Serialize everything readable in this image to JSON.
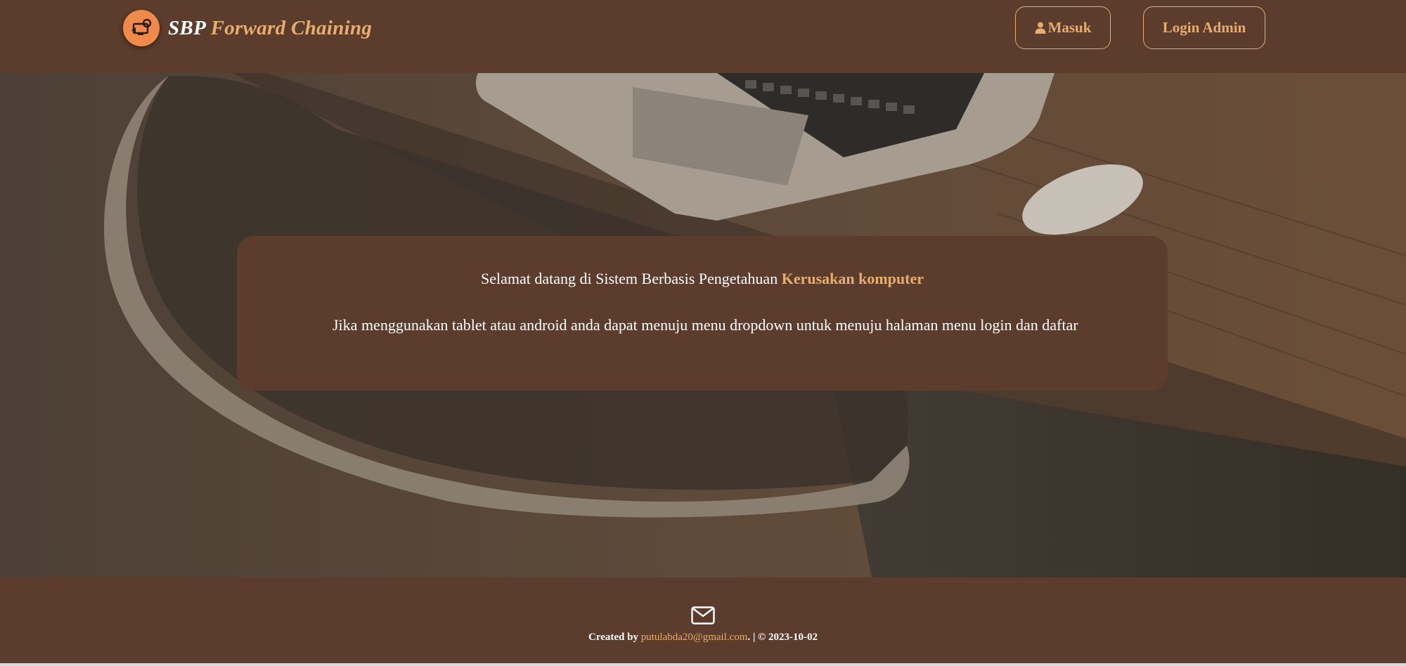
{
  "navbar": {
    "brand_part1": "SBP",
    "brand_part2": "Forward Chaining",
    "logo_icon": "computer-repair-logo-icon",
    "masuk_label": "Masuk",
    "masuk_icon": "user-icon",
    "admin_label": "Login Admin"
  },
  "hero": {
    "welcome_prefix": "Selamat datang di Sistem Berbasis Pengetahuan ",
    "welcome_highlight": "Kerusakan komputer",
    "info": "Jika menggunakan tablet atau android anda dapat menuju menu dropdown untuk menuju halaman menu login dan daftar"
  },
  "footer": {
    "mail_icon": "envelope-icon",
    "created_by": "Created by ",
    "email": "putulabda20@gmail.com",
    "suffix": ". | © 2023-10-02"
  },
  "colors": {
    "brown": "#5b3c2d",
    "accent": "#e6ad6e",
    "logo_orange": "#f08a4b"
  }
}
